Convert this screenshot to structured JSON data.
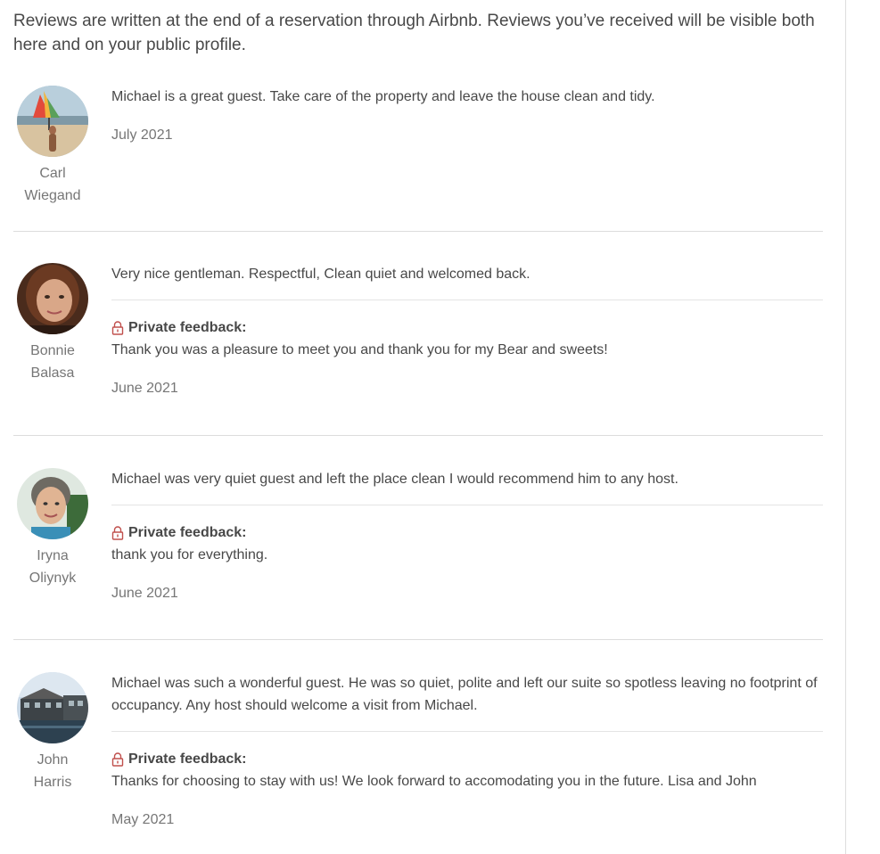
{
  "intro": "Reviews are written at the end of a reservation through Airbnb. Reviews you’ve received will be visible both here and on your public profile.",
  "private_feedback_label": "Private feedback:",
  "reviews": [
    {
      "first_name": "Carl",
      "last_name": "Wiegand",
      "text": "Michael is a great guest. Take care of the property and leave the house clean and tidy.",
      "date": "July 2021"
    },
    {
      "first_name": "Bonnie",
      "last_name": "Balasa",
      "text": "Very nice gentleman. Respectful, Clean quiet and welcomed back.",
      "private_feedback": "Thank you was a pleasure to meet you and thank you for my Bear and sweets!",
      "date": "June 2021"
    },
    {
      "first_name": "Iryna",
      "last_name": "Oliynyk",
      "text": "Michael was very quiet guest and left the place clean I would recommend him to any host.",
      "private_feedback": "thank you for everything.",
      "date": "June 2021"
    },
    {
      "first_name": "John",
      "last_name": "Harris",
      "text": "Michael was such a wonderful guest. He was so quiet, polite and left our suite so spotless leaving no footprint of occupancy. Any host should welcome a visit from Michael.",
      "private_feedback": "Thanks for choosing to stay with us! We look forward to accomodating you in the future. Lisa and John",
      "date": "May 2021"
    }
  ],
  "colors": {
    "text": "#484848",
    "muted": "#767676",
    "divider": "#dcdcdc",
    "lock": "#c0504d"
  }
}
